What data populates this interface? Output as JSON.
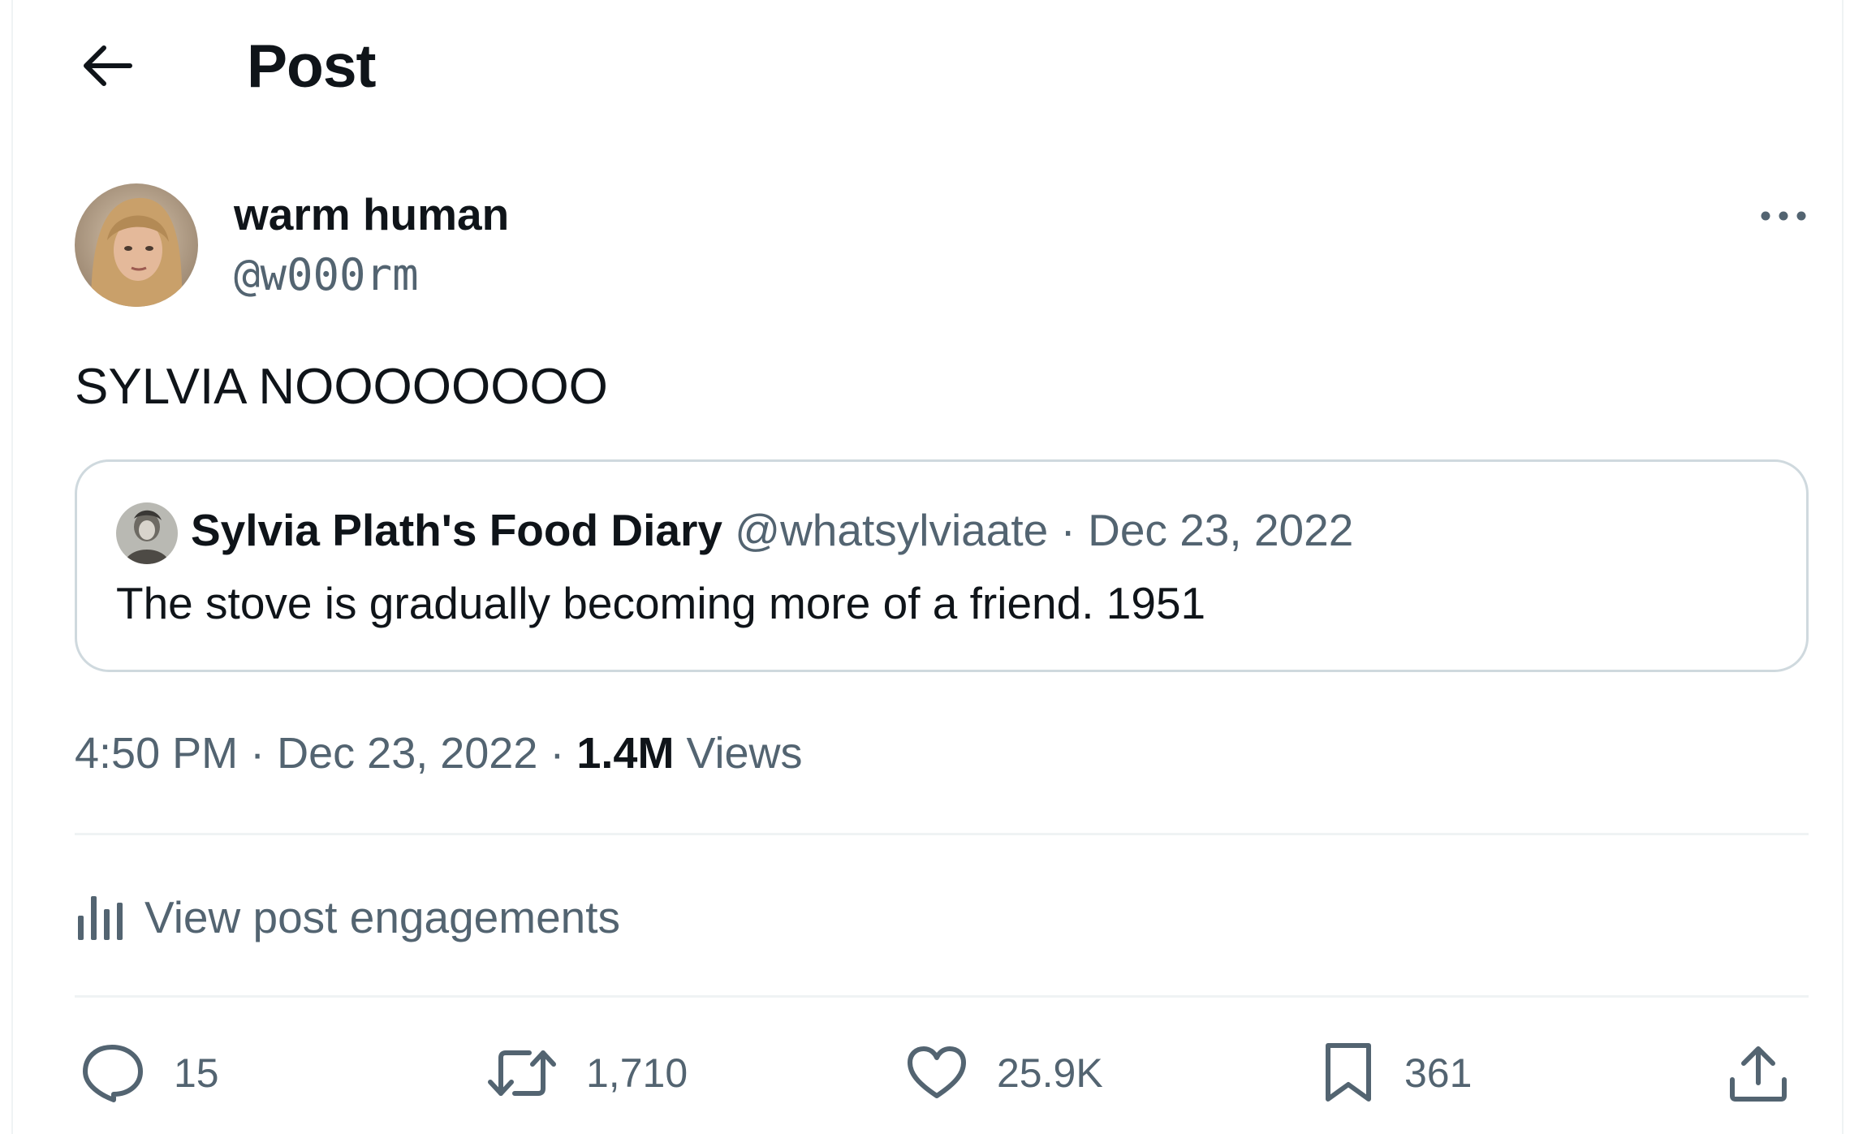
{
  "header": {
    "title": "Post"
  },
  "post": {
    "author": {
      "display_name": "warm human",
      "handle": "@w000rm"
    },
    "text": "SYLVIA NOOOOOOOO",
    "quote": {
      "author_name": "Sylvia Plath's Food Diary",
      "author_handle": "@whatsylviaate",
      "separator": "·",
      "date": "Dec 23, 2022",
      "text": "The stove is gradually becoming more of a friend. 1951"
    },
    "meta": {
      "time": "4:50 PM",
      "sep1": "·",
      "date": "Dec 23, 2022",
      "sep2": "·",
      "views_count": "1.4M",
      "views_label": "Views"
    },
    "engagements_label": "View post engagements",
    "actions": {
      "replies": "15",
      "reposts": "1,710",
      "likes": "25.9K",
      "bookmarks": "361"
    }
  },
  "icons": {
    "back": "arrow-left-icon",
    "more": "more-horizontal-icon",
    "engagements": "bar-chart-icon",
    "reply": "speech-bubble-icon",
    "repost": "repost-arrows-icon",
    "like": "heart-icon",
    "bookmark": "bookmark-icon",
    "share": "share-upload-icon"
  },
  "colors": {
    "text_primary": "#0f1419",
    "text_secondary": "#536471",
    "border": "#cfd9de",
    "divider": "#eff3f4"
  }
}
